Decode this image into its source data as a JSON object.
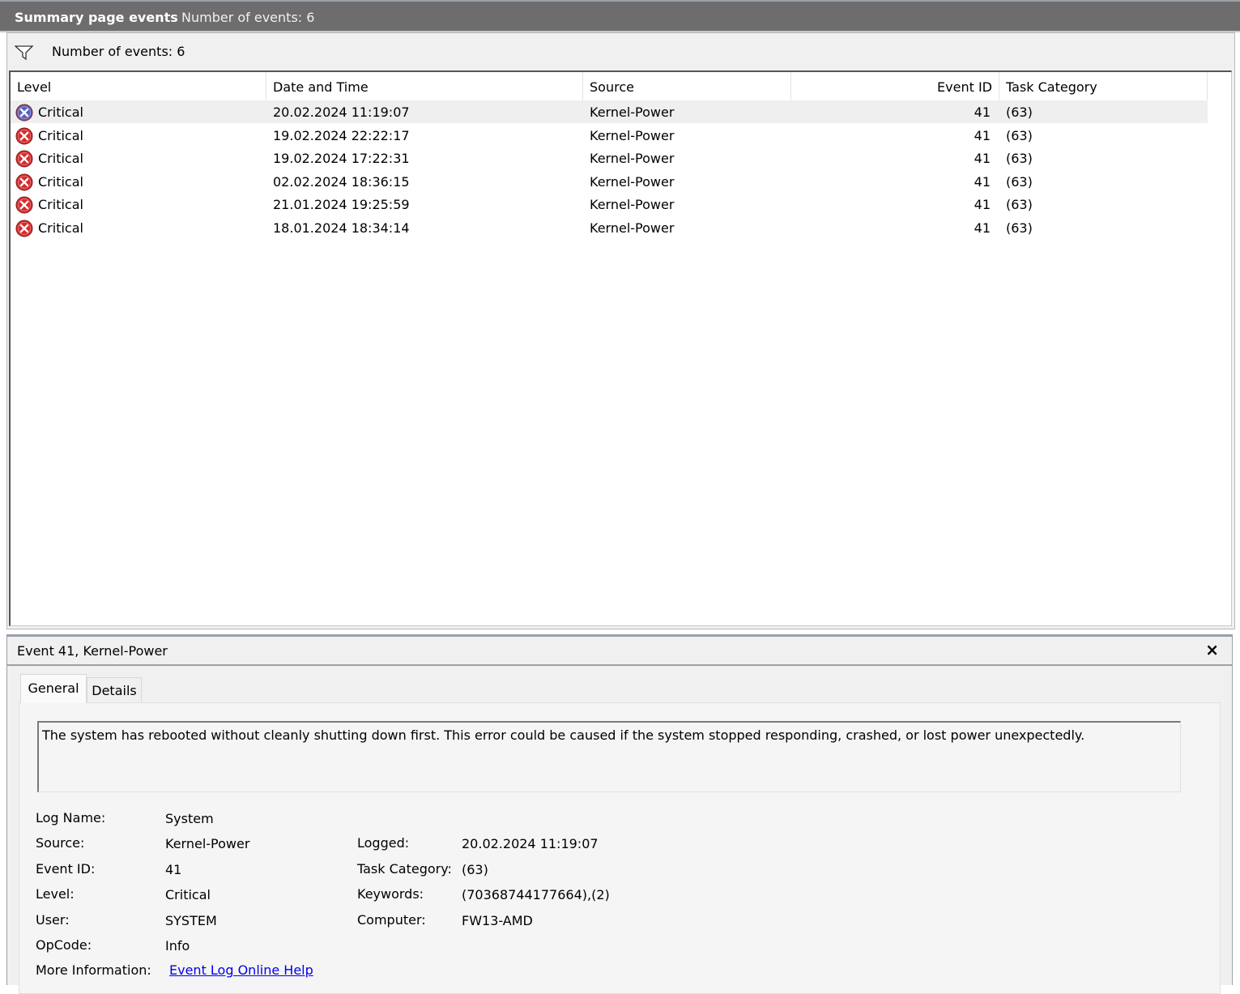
{
  "titlebar": {
    "title": "Summary page events",
    "count": "Number of events: 6"
  },
  "filterbar": {
    "icon": "filter-icon",
    "text": "Number of events: 6"
  },
  "columns": {
    "level": "Level",
    "datetime": "Date and Time",
    "source": "Source",
    "eventid": "Event ID",
    "task": "Task Category"
  },
  "events": [
    {
      "level": "Critical",
      "datetime": "20.02.2024 11:19:07",
      "source": "Kernel-Power",
      "eventid": "41",
      "task": "(63)"
    },
    {
      "level": "Critical",
      "datetime": "19.02.2024 22:22:17",
      "source": "Kernel-Power",
      "eventid": "41",
      "task": "(63)"
    },
    {
      "level": "Critical",
      "datetime": "19.02.2024 17:22:31",
      "source": "Kernel-Power",
      "eventid": "41",
      "task": "(63)"
    },
    {
      "level": "Critical",
      "datetime": "02.02.2024 18:36:15",
      "source": "Kernel-Power",
      "eventid": "41",
      "task": "(63)"
    },
    {
      "level": "Critical",
      "datetime": "21.01.2024 19:25:59",
      "source": "Kernel-Power",
      "eventid": "41",
      "task": "(63)"
    },
    {
      "level": "Critical",
      "datetime": "18.01.2024 18:34:14",
      "source": "Kernel-Power",
      "eventid": "41",
      "task": "(63)"
    }
  ],
  "selected_row": 0,
  "detail": {
    "title": "Event 41, Kernel-Power",
    "close": "×",
    "tabs": {
      "general": "General",
      "details": "Details"
    },
    "description": "The system has rebooted without cleanly shutting down first. This error could be caused if the system stopped responding, crashed, or lost power unexpectedly.",
    "labels": {
      "log_name": "Log Name:",
      "source": "Source:",
      "event_id": "Event ID:",
      "level": "Level:",
      "user": "User:",
      "opcode": "OpCode:",
      "more_info": "More Information:",
      "logged": "Logged:",
      "task_category": "Task Category:",
      "keywords": "Keywords:",
      "computer": "Computer:"
    },
    "values": {
      "log_name": "System",
      "source": "Kernel-Power",
      "event_id": "41",
      "level": "Critical",
      "user": "SYSTEM",
      "opcode": "Info",
      "more_info": "Event Log Online Help",
      "logged": "20.02.2024 11:19:07",
      "task_category": "(63)",
      "keywords": "(70368744177664),(2)",
      "computer": "FW13-AMD"
    }
  },
  "colors": {
    "critical": "#d42b2b",
    "critical_selected": "#5b5fb8",
    "link": "#0000ee"
  }
}
